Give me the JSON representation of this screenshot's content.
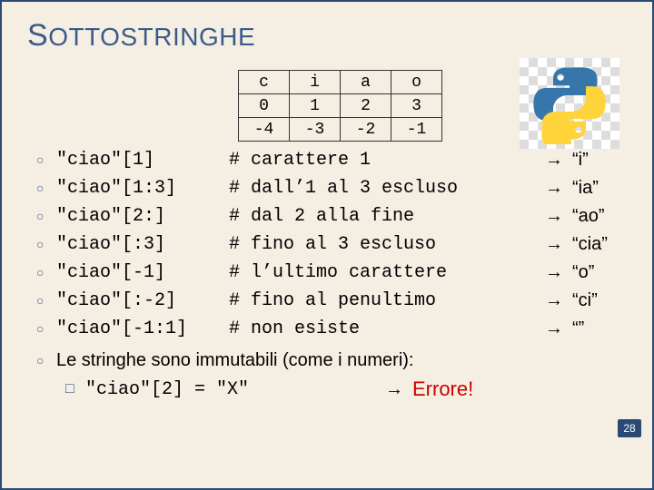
{
  "title_first": "S",
  "title_rest": "OTTOSTRINGHE",
  "table": {
    "r0": [
      "c",
      "i",
      "a",
      "o"
    ],
    "r1": [
      "0",
      "1",
      "2",
      "3"
    ],
    "r2": [
      "-4",
      "-3",
      "-2",
      "-1"
    ]
  },
  "rows": [
    {
      "expr": "\"ciao\"[1]",
      "comment": "# carattere 1",
      "res": "“i”"
    },
    {
      "expr": "\"ciao\"[1:3]",
      "comment": "# dall’1 al 3 escluso",
      "res": "“ia”"
    },
    {
      "expr": "\"ciao\"[2:]",
      "comment": "# dal 2 alla fine",
      "res": "“ao”"
    },
    {
      "expr": "\"ciao\"[:3]",
      "comment": "# fino al 3 escluso",
      "res": "“cia”"
    },
    {
      "expr": "\"ciao\"[-1]",
      "comment": "# l’ultimo carattere",
      "res": "“o”"
    },
    {
      "expr": "\"ciao\"[:-2]",
      "comment": "# fino al penultimo",
      "res": "“ci”"
    },
    {
      "expr": "\"ciao\"[-1:1]",
      "comment": "# non esiste",
      "res": "“”"
    }
  ],
  "note": "Le stringhe sono immutabili (come  i numeri):",
  "assign": "\"ciao\"[2] = \"X\"",
  "arrow": "→",
  "error": "Errore!",
  "page": "28"
}
